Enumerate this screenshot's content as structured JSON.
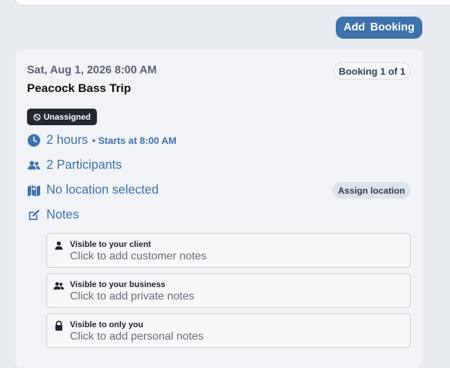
{
  "toolbar": {
    "add_booking_label": "Add  Booking"
  },
  "booking": {
    "date": "Sat, Aug 1, 2026 8:00 AM",
    "title": "Peacock Bass Trip",
    "counter": "Booking 1 of 1",
    "status_badge": "Unassigned",
    "duration": "2 hours",
    "starts_at": "• Starts at 8:00 AM",
    "participants": "2 Participants",
    "location": "No location selected",
    "assign_location_label": "Assign location",
    "notes_label": "Notes"
  },
  "notes": [
    {
      "title": "Visible to your client",
      "placeholder": "Click to add customer notes",
      "icon": "person-icon"
    },
    {
      "title": "Visible to your business",
      "placeholder": "Click to add private notes",
      "icon": "users-icon"
    },
    {
      "title": "Visible to only you",
      "placeholder": "Click to add personal notes",
      "icon": "lock-icon"
    }
  ],
  "colors": {
    "accent": "#3d72ac",
    "background": "#e8ebf0",
    "card": "#f1f3f6",
    "badge_dark": "#22282f"
  }
}
